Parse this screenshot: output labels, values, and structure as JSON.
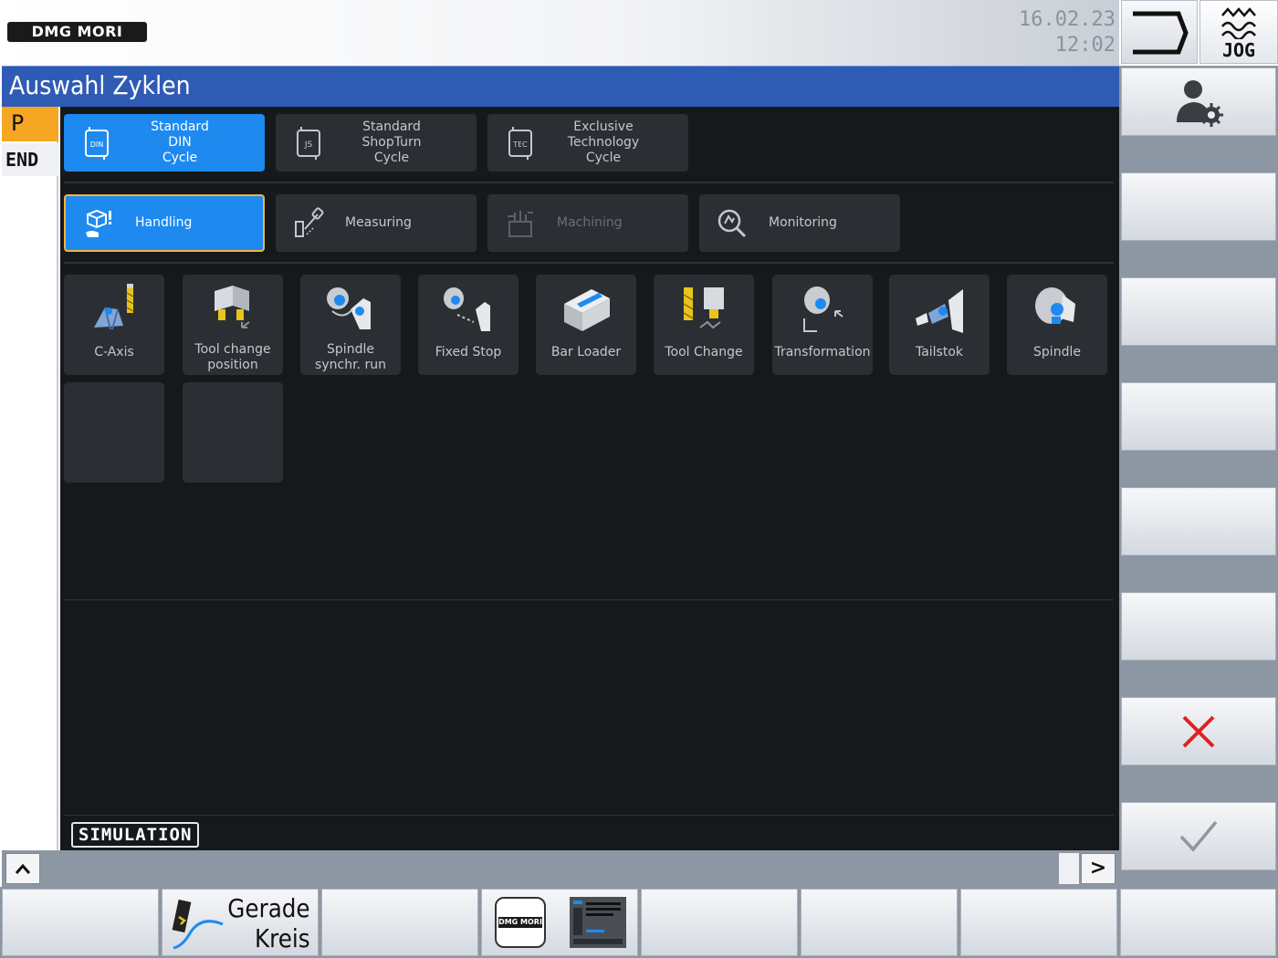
{
  "header": {
    "brand": "DMG MORI",
    "date": "16.02.23",
    "time": "12:02",
    "mode_label": "JOG"
  },
  "title": "Auswahl Zyklen",
  "program_block": {
    "line1": "P",
    "line2": "END"
  },
  "cycle_tabs": [
    {
      "lines": [
        "Standard",
        "DIN",
        "Cycle"
      ],
      "icon": "din-cycle-icon",
      "badge": "DIN",
      "active": true
    },
    {
      "lines": [
        "Standard",
        "ShopTurn",
        "Cycle"
      ],
      "icon": "shopturn-cycle-icon",
      "badge": "JS",
      "active": false
    },
    {
      "lines": [
        "Exclusive",
        "Technology",
        "Cycle"
      ],
      "icon": "technology-cycle-icon",
      "badge": "TEC",
      "active": false
    }
  ],
  "category_tabs": [
    {
      "label": "Handling",
      "icon": "handling-icon",
      "active": true
    },
    {
      "label": "Measuring",
      "icon": "measuring-icon",
      "active": false
    },
    {
      "label": "Machining",
      "icon": "machining-icon",
      "active": false,
      "disabled": true
    },
    {
      "label": "Monitoring",
      "icon": "monitoring-icon",
      "active": false
    }
  ],
  "cycle_items": [
    {
      "lines": [
        "C-Axis"
      ],
      "icon": "c-axis-icon"
    },
    {
      "lines": [
        "Tool change",
        "position"
      ],
      "icon": "tool-change-position-icon"
    },
    {
      "lines": [
        "Spindle",
        "synchr. run"
      ],
      "icon": "spindle-synchr-run-icon"
    },
    {
      "lines": [
        "Fixed Stop"
      ],
      "icon": "fixed-stop-icon"
    },
    {
      "lines": [
        "Bar Loader"
      ],
      "icon": "bar-loader-icon"
    },
    {
      "lines": [
        "Tool Change"
      ],
      "icon": "tool-change-icon"
    },
    {
      "lines": [
        "Transformation"
      ],
      "icon": "transformation-icon"
    },
    {
      "lines": [
        "Tailstok"
      ],
      "icon": "tailstock-icon"
    },
    {
      "lines": [
        "Spindle"
      ],
      "icon": "spindle-icon"
    }
  ],
  "simulation_label": "SIMULATION",
  "scroll": {
    "up_symbol": "^",
    "right_symbol": ">"
  },
  "right_softkeys": [
    {
      "icon": "user-settings-icon"
    },
    {
      "icon": ""
    },
    {
      "icon": ""
    },
    {
      "icon": ""
    },
    {
      "icon": ""
    },
    {
      "icon": ""
    },
    {
      "icon": "cancel-x-icon"
    },
    {
      "icon": "confirm-check-icon"
    }
  ],
  "bottom_softkeys": {
    "gerade_kreis": [
      "Gerade",
      "Kreis"
    ],
    "dmg_button_text": "DMG MORI"
  },
  "colors": {
    "accent_blue": "#1e8af0",
    "title_blue": "#2f5bb5",
    "program_orange": "#f5a623",
    "cancel_red": "#e02020",
    "tile_bg": "#2b2f34",
    "panel_bg": "#16191c"
  }
}
